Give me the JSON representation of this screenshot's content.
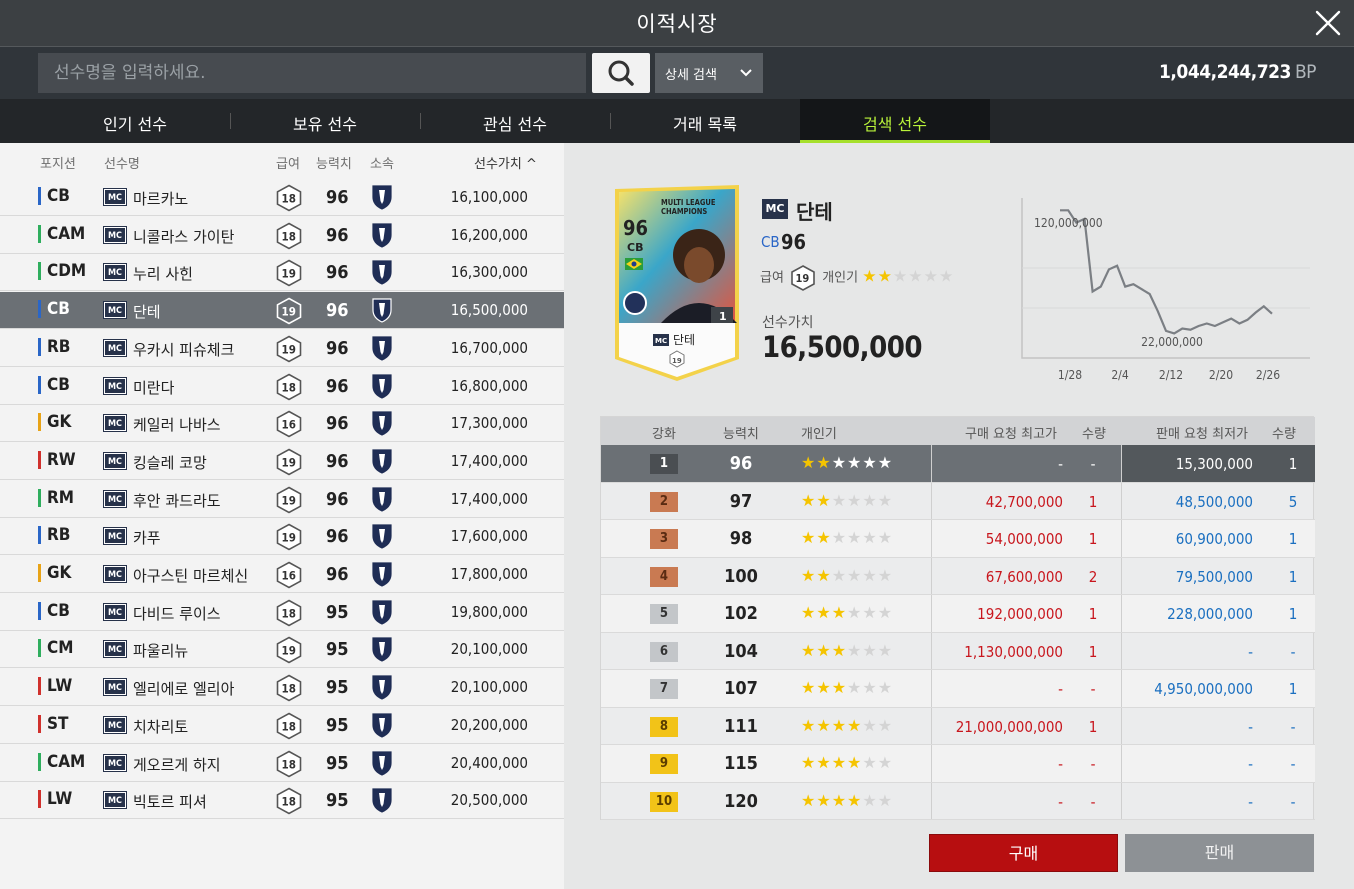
{
  "window": {
    "title": "이적시장"
  },
  "search": {
    "placeholder": "선수명을 입력하세요.",
    "detail_label": "상세 검색",
    "balance": "1,044,244,723",
    "balance_unit": "BP"
  },
  "tabs": [
    {
      "label": "인기 선수",
      "active": false
    },
    {
      "label": "보유 선수",
      "active": false
    },
    {
      "label": "관심 선수",
      "active": false
    },
    {
      "label": "거래 목록",
      "active": false
    },
    {
      "label": "검색 선수",
      "active": true
    }
  ],
  "list": {
    "headers": {
      "position": "포지션",
      "name": "선수명",
      "pay": "급여",
      "ovr": "능력치",
      "club": "소속",
      "value": "선수가치 ^"
    },
    "season_badge": "MC",
    "rows": [
      {
        "pos": "CB",
        "pos_color": "#2a66c7",
        "name": "마르카노",
        "pay": "18",
        "ovr": "96",
        "value": "16,100,000"
      },
      {
        "pos": "CAM",
        "pos_color": "#2fae5e",
        "name": "니콜라스 가이탄",
        "pay": "18",
        "ovr": "96",
        "value": "16,200,000"
      },
      {
        "pos": "CDM",
        "pos_color": "#2fae5e",
        "name": "누리 사힌",
        "pay": "19",
        "ovr": "96",
        "value": "16,300,000"
      },
      {
        "pos": "CB",
        "pos_color": "#2a66c7",
        "name": "단테",
        "pay": "19",
        "ovr": "96",
        "value": "16,500,000",
        "selected": true
      },
      {
        "pos": "RB",
        "pos_color": "#2a66c7",
        "name": "우카시 피슈체크",
        "pay": "19",
        "ovr": "96",
        "value": "16,700,000"
      },
      {
        "pos": "CB",
        "pos_color": "#2a66c7",
        "name": "미란다",
        "pay": "18",
        "ovr": "96",
        "value": "16,800,000"
      },
      {
        "pos": "GK",
        "pos_color": "#e8a317",
        "name": "케일러 나바스",
        "pay": "16",
        "ovr": "96",
        "value": "17,300,000"
      },
      {
        "pos": "RW",
        "pos_color": "#d0312d",
        "name": "킹슬레 코망",
        "pay": "19",
        "ovr": "96",
        "value": "17,400,000"
      },
      {
        "pos": "RM",
        "pos_color": "#2fae5e",
        "name": "후안 콰드라도",
        "pay": "19",
        "ovr": "96",
        "value": "17,400,000"
      },
      {
        "pos": "RB",
        "pos_color": "#2a66c7",
        "name": "카푸",
        "pay": "19",
        "ovr": "96",
        "value": "17,600,000"
      },
      {
        "pos": "GK",
        "pos_color": "#e8a317",
        "name": "아구스틴 마르체신",
        "pay": "16",
        "ovr": "96",
        "value": "17,800,000"
      },
      {
        "pos": "CB",
        "pos_color": "#2a66c7",
        "name": "다비드 루이스",
        "pay": "18",
        "ovr": "95",
        "value": "19,800,000"
      },
      {
        "pos": "CM",
        "pos_color": "#2fae5e",
        "name": "파울리뉴",
        "pay": "19",
        "ovr": "95",
        "value": "20,100,000"
      },
      {
        "pos": "LW",
        "pos_color": "#d0312d",
        "name": "엘리에로 엘리아",
        "pay": "18",
        "ovr": "95",
        "value": "20,100,000"
      },
      {
        "pos": "ST",
        "pos_color": "#d0312d",
        "name": "치차리토",
        "pay": "18",
        "ovr": "95",
        "value": "20,200,000"
      },
      {
        "pos": "CAM",
        "pos_color": "#2fae5e",
        "name": "게오르게 하지",
        "pay": "18",
        "ovr": "95",
        "value": "20,400,000"
      },
      {
        "pos": "LW",
        "pos_color": "#d0312d",
        "name": "빅토르 피셔",
        "pay": "18",
        "ovr": "95",
        "value": "20,500,000"
      }
    ]
  },
  "player": {
    "season": "MC",
    "name": "단테",
    "pos": "CB",
    "ovr": "96",
    "pay_label": "급여",
    "pay": "19",
    "pop_label": "개인기",
    "skill_stars": 2,
    "value_label": "선수가치",
    "value": "16,500,000",
    "card": {
      "ovr": "96",
      "pos": "CB",
      "season_text_1": "MULTI LEAGUE",
      "season_text_2": "CHAMPIONS",
      "name": "단테",
      "pay": "19",
      "enhance": "1"
    }
  },
  "price_chart": {
    "y_high_label": "120,000,000",
    "y_low_label": "22,000,000",
    "x_labels": [
      "1/28",
      "2/4",
      "2/12",
      "2/20",
      "2/26"
    ]
  },
  "chart_data": {
    "type": "line",
    "title": "",
    "xlabel": "",
    "ylabel": "",
    "x_ticks": [
      "1/28",
      "2/4",
      "2/12",
      "2/20",
      "2/26"
    ],
    "y_ticks": [
      120000000,
      22000000
    ],
    "series": [
      {
        "values": [
          120000000,
          120000000,
          110000000,
          113000000,
          54000000,
          58000000,
          72000000,
          75000000,
          58000000,
          60000000,
          56000000,
          52000000,
          38000000,
          22000000,
          20000000,
          24000000,
          23000000,
          26000000,
          28000000,
          26000000,
          29000000,
          32000000,
          28000000,
          31000000,
          37000000,
          42000000,
          36000000
        ]
      }
    ],
    "grid": true
  },
  "upgrade_table": {
    "headers": {
      "enhance": "강화",
      "ovr": "능력치",
      "pop": "개인기",
      "buy_max": "구매 요청 최고가",
      "buy_qty": "수량",
      "sell_min": "판매 요청 최저가",
      "sell_qty": "수량"
    },
    "rows": [
      {
        "level": "1",
        "badge_color": "#4a4e52",
        "badge_text_color": "#ffffff",
        "ovr": "96",
        "stars": 2,
        "buy": "-",
        "buy_qty": "-",
        "sell": "15,300,000",
        "sell_qty": "1"
      },
      {
        "level": "2",
        "badge_color": "#c97a52",
        "badge_text_color": "#5a2b12",
        "ovr": "97",
        "stars": 2,
        "buy": "42,700,000",
        "buy_qty": "1",
        "sell": "48,500,000",
        "sell_qty": "5"
      },
      {
        "level": "3",
        "badge_color": "#c97a52",
        "badge_text_color": "#5a2b12",
        "ovr": "98",
        "stars": 2,
        "buy": "54,000,000",
        "buy_qty": "1",
        "sell": "60,900,000",
        "sell_qty": "1"
      },
      {
        "level": "4",
        "badge_color": "#c97a52",
        "badge_text_color": "#5a2b12",
        "ovr": "100",
        "stars": 2,
        "buy": "67,600,000",
        "buy_qty": "2",
        "sell": "79,500,000",
        "sell_qty": "1"
      },
      {
        "level": "5",
        "badge_color": "#c3c6c9",
        "badge_text_color": "#333333",
        "ovr": "102",
        "stars": 3,
        "buy": "192,000,000",
        "buy_qty": "1",
        "sell": "228,000,000",
        "sell_qty": "1"
      },
      {
        "level": "6",
        "badge_color": "#c3c6c9",
        "badge_text_color": "#333333",
        "ovr": "104",
        "stars": 3,
        "buy": "1,130,000,000",
        "buy_qty": "1",
        "sell": "-",
        "sell_qty": "-"
      },
      {
        "level": "7",
        "badge_color": "#c3c6c9",
        "badge_text_color": "#333333",
        "ovr": "107",
        "stars": 3,
        "buy": "-",
        "buy_qty": "-",
        "sell": "4,950,000,000",
        "sell_qty": "1"
      },
      {
        "level": "8",
        "badge_color": "#f2c318",
        "badge_text_color": "#5a3d00",
        "ovr": "111",
        "stars": 4,
        "buy": "21,000,000,000",
        "buy_qty": "1",
        "sell": "-",
        "sell_qty": "-"
      },
      {
        "level": "9",
        "badge_color": "#f2c318",
        "badge_text_color": "#5a3d00",
        "ovr": "115",
        "stars": 4,
        "buy": "-",
        "buy_qty": "-",
        "sell": "-",
        "sell_qty": "-"
      },
      {
        "level": "10",
        "badge_color": "#f2c318",
        "badge_text_color": "#5a3d00",
        "ovr": "120",
        "stars": 4,
        "buy": "-",
        "buy_qty": "-",
        "sell": "-",
        "sell_qty": "-"
      }
    ]
  },
  "actions": {
    "buy": "구매",
    "sell": "판매"
  }
}
